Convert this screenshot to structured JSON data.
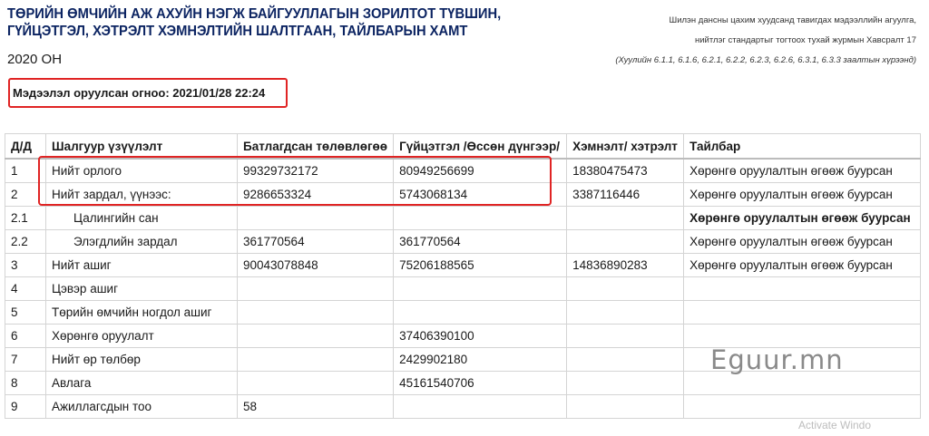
{
  "header": {
    "title": "ТӨРИЙН ӨМЧИЙН АЖ АХУЙН НЭГЖ БАЙГУУЛЛАГЫН ЗОРИЛТОТ ТҮВШИН, ГҮЙЦЭТГЭЛ, ХЭТРЭЛТ ХЭМНЭЛТИЙН ШАЛТГААН, ТАЙЛБАРЫН ХАМТ",
    "year": "2020 ОН",
    "regulation_line1": "Шилэн дансны цахим хуудсанд тавигдах мэдээллийн агуулга,",
    "regulation_line2": "нийтлэг стандартыг тогтоох тухай журмын Хавсралт 17",
    "regulation_ref": "(Хуулийн 6.1.1, 6.1.6, 6.2.1, 6.2.2, 6.2.3, 6.2.6, 6.3.1, 6.3.3 заалтын хүрээнд)"
  },
  "upload": {
    "text": "Мэдээлэл оруулсан огноо: 2021/01/28 22:24"
  },
  "table": {
    "headers": [
      "Д/Д",
      "Шалгуур үзүүлэлт",
      "Батлагдсан төлөвлөгөө",
      "Гүйцэтгэл /Өссөн дүнгээр/",
      "Хэмнэлт/ хэтрэлт",
      "Тайлбар"
    ],
    "rows": [
      [
        "1",
        "Нийт орлого",
        "99329732172",
        "80949256699",
        "18380475473",
        "Хөрөнгө оруулалтын өгөөж буурсан"
      ],
      [
        "2",
        "Нийт зардал, үүнээс:",
        "9286653324",
        "5743068134",
        "3387116446",
        "Хөрөнгө оруулалтын өгөөж буурсан"
      ],
      [
        "2.1",
        "Цалингийн сан",
        "",
        "",
        "",
        "Хөрөнгө оруулалтын өгөөж буурсан"
      ],
      [
        "2.2",
        "Элэгдлийн зардал",
        "361770564",
        "361770564",
        "",
        "Хөрөнгө оруулалтын өгөөж буурсан"
      ],
      [
        "3",
        "Нийт ашиг",
        "90043078848",
        "75206188565",
        "14836890283",
        "Хөрөнгө оруулалтын өгөөж буурсан"
      ],
      [
        "4",
        "Цэвэр ашиг",
        "",
        "",
        "",
        ""
      ],
      [
        "5",
        "Төрийн өмчийн ногдол ашиг",
        "",
        "",
        "",
        ""
      ],
      [
        "6",
        "Хөрөнгө оруулалт",
        "",
        "37406390100",
        "",
        ""
      ],
      [
        "7",
        "Нийт өр төлбөр",
        "",
        "2429902180",
        "",
        ""
      ],
      [
        "8",
        "Авлага",
        "",
        "45161540706",
        "",
        ""
      ],
      [
        "9",
        "Ажиллагсдын тоо",
        "58",
        "",
        "",
        ""
      ]
    ]
  },
  "watermark": "Eguur.mn",
  "os_overlay": "Activate Windo"
}
